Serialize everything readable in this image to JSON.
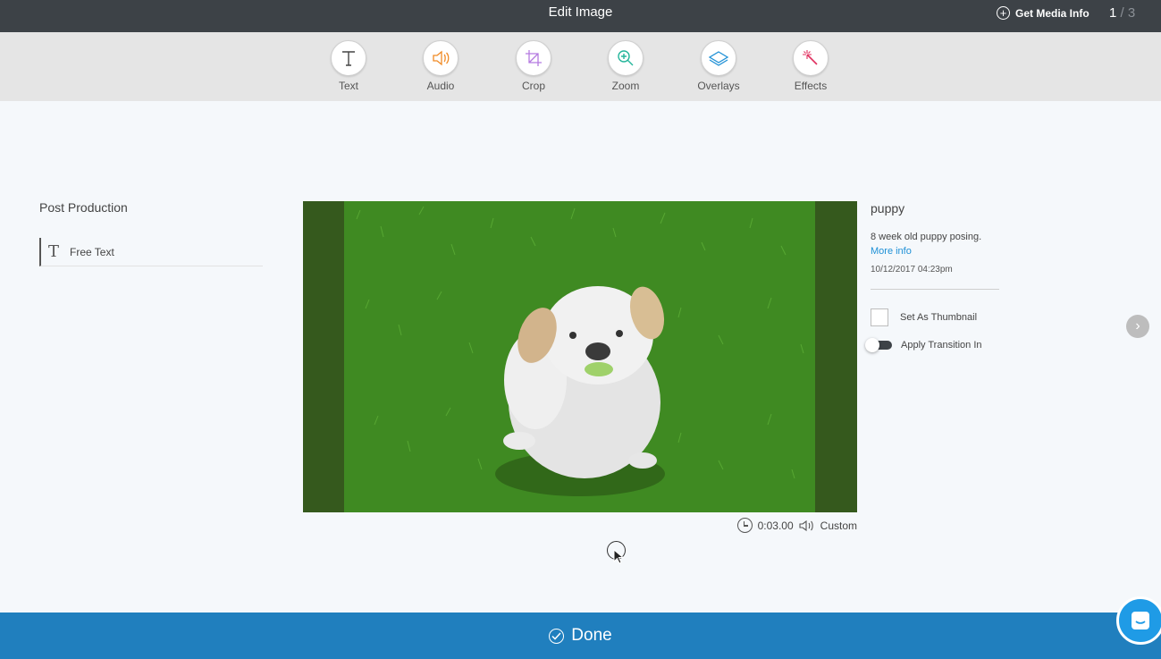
{
  "header": {
    "title": "Edit Image",
    "media_info_label": "Get Media Info",
    "pager": {
      "current": "1",
      "separator": "/",
      "total": "3"
    }
  },
  "toolbar": {
    "tools": [
      {
        "label": "Text",
        "icon": "text-icon"
      },
      {
        "label": "Audio",
        "icon": "audio-icon",
        "color": "#f08a24"
      },
      {
        "label": "Crop",
        "icon": "crop-icon",
        "color": "#b57be0"
      },
      {
        "label": "Zoom",
        "icon": "zoom-icon",
        "color": "#23b59a"
      },
      {
        "label": "Overlays",
        "icon": "layers-icon",
        "color": "#1e90d6"
      },
      {
        "label": "Effects",
        "icon": "magic-wand-icon",
        "color": "#e0305f"
      }
    ]
  },
  "left_panel": {
    "title": "Post Production",
    "items": [
      {
        "label": "Free Text",
        "icon": "text-icon"
      }
    ]
  },
  "media": {
    "duration": "0:03.00",
    "audio_label": "Custom"
  },
  "info_panel": {
    "name": "puppy",
    "description": "8 week old puppy posing.",
    "more_info": "More info",
    "date": "10/12/2017 04:23pm",
    "thumbnail_label": "Set As Thumbnail",
    "thumbnail_checked": false,
    "transition_label": "Apply Transition In",
    "transition_on": false
  },
  "footer": {
    "done_label": "Done"
  },
  "colors": {
    "header": "#3d4247",
    "toolbar": "#e5e5e5",
    "accent": "#207fbe",
    "link": "#1e90d6"
  }
}
